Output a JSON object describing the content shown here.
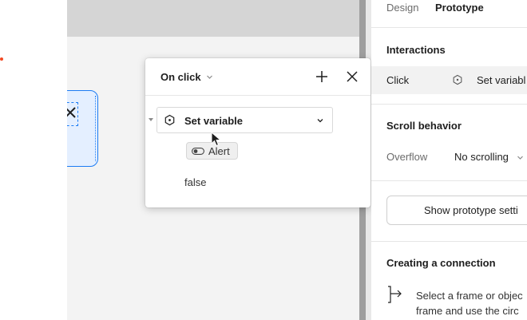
{
  "canvas": {
    "frame_icon": "close-x-icon"
  },
  "popover": {
    "trigger": "On click",
    "action": "Set variable",
    "variable": "Alert",
    "value": "false",
    "icons": {
      "add": "plus-icon",
      "close": "close-icon",
      "action": "variable-hexagon-icon",
      "variable": "toggle-icon"
    }
  },
  "panel": {
    "tabs": [
      "Design",
      "Prototype"
    ],
    "active_tab": "Prototype",
    "interactions": {
      "title": "Interactions",
      "trigger": "Click",
      "action": "Set variabl"
    },
    "scroll": {
      "title": "Scroll behavior",
      "overflow_label": "Overflow",
      "overflow_value": "No scrolling"
    },
    "settings_button": "Show prototype setti",
    "connection": {
      "title": "Creating a connection",
      "line1": "Select a frame or objec",
      "line2": "frame and use the circ"
    }
  },
  "colors": {
    "accent": "#1c7cf4",
    "frame_fill": "#e4efff",
    "alert_dot": "#f24822",
    "divider": "#9e9e9e"
  }
}
